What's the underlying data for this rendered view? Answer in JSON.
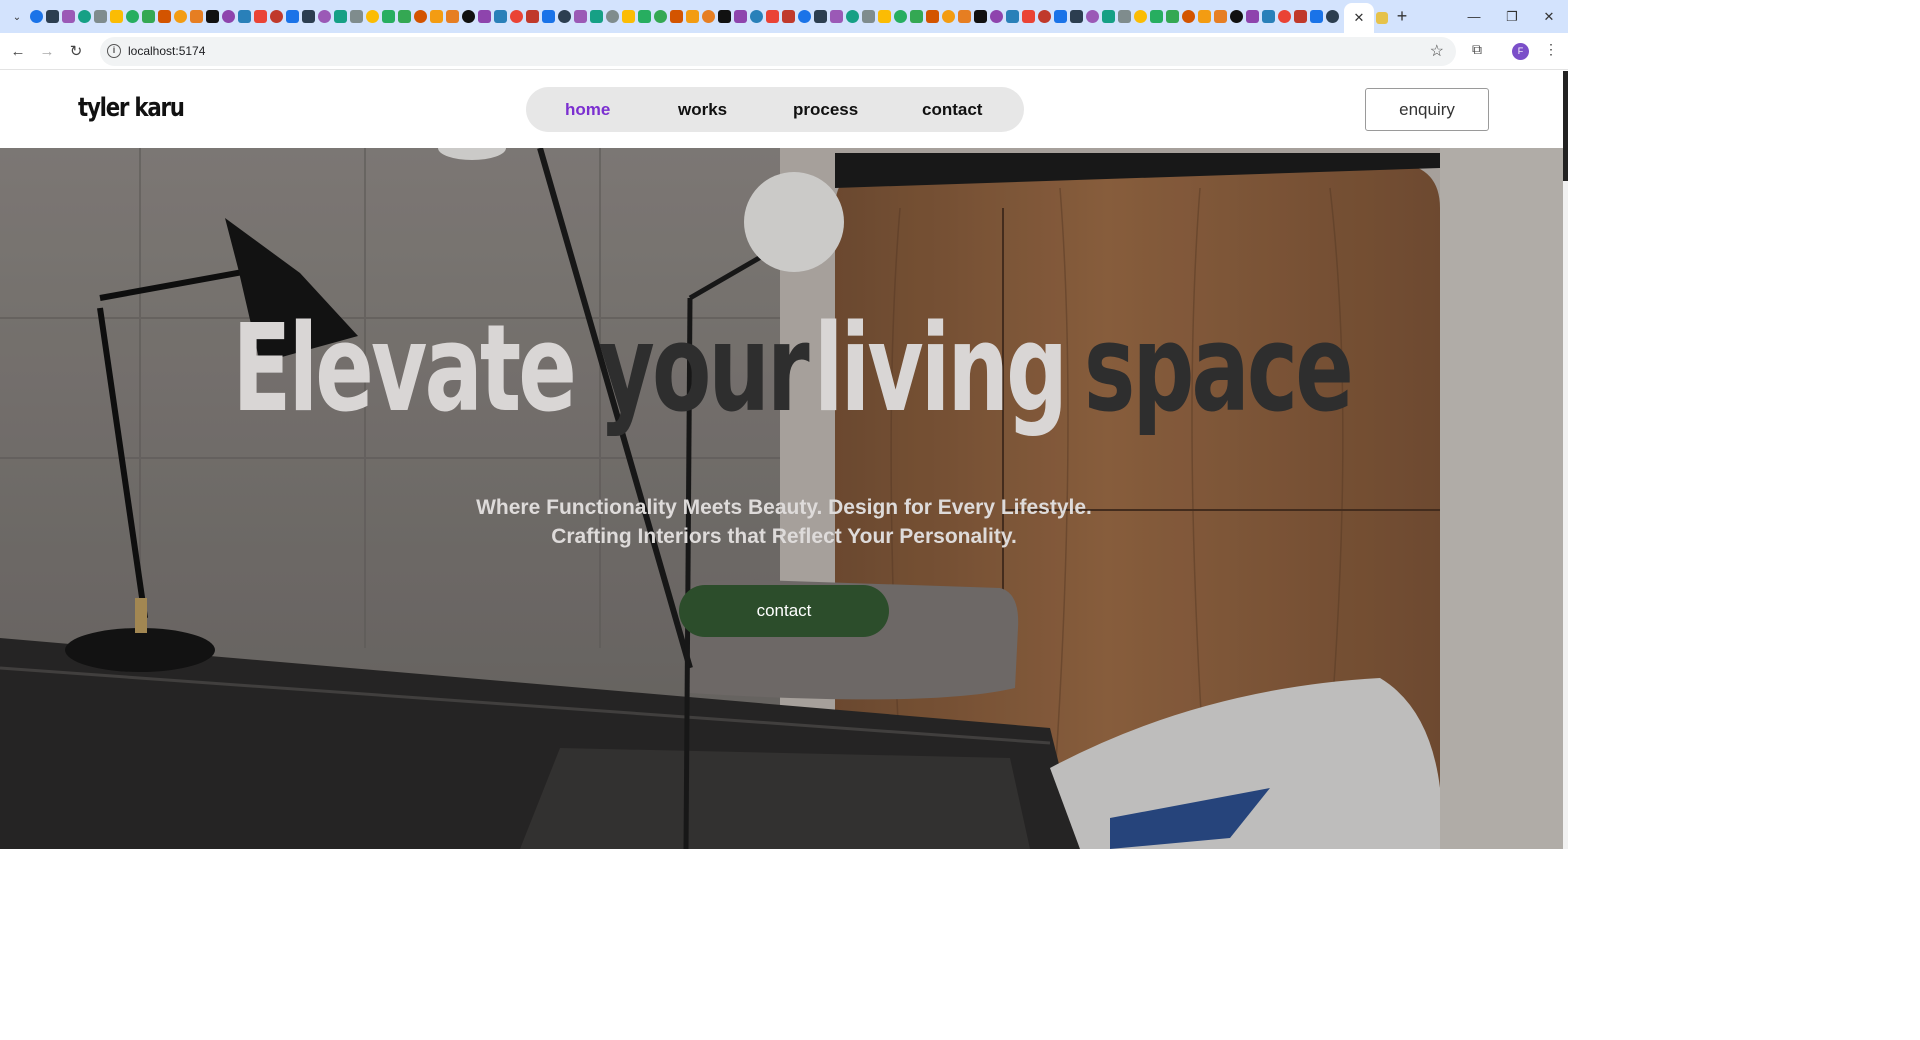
{
  "browser": {
    "url": "localhost:5174",
    "profile_initial": "F",
    "tab_close_glyph": "✕",
    "new_tab_glyph": "+",
    "window_controls": [
      "—",
      "❐",
      "✕"
    ],
    "icons": [
      "back-icon",
      "forward-icon",
      "reload-icon",
      "site-info-icon",
      "bookmark-star-icon",
      "extensions-icon",
      "kebab-menu-icon"
    ]
  },
  "site": {
    "logo": "tyler karu",
    "nav": [
      {
        "label": "home",
        "active": true
      },
      {
        "label": "works",
        "active": false
      },
      {
        "label": "process",
        "active": false
      },
      {
        "label": "contact",
        "active": false
      }
    ],
    "enquiry_label": "enquiry"
  },
  "hero": {
    "headline_words": [
      {
        "text": "Elevate",
        "tone": "light"
      },
      {
        "text": "your",
        "tone": "dark"
      },
      {
        "text": "living",
        "tone": "light"
      },
      {
        "text": "space",
        "tone": "dark"
      }
    ],
    "tagline_line1": "Where Functionality Meets Beauty. Design for Every Lifestyle.",
    "tagline_line2": "Crafting Interiors that Reflect Your Personality.",
    "cta_label": "contact"
  },
  "colors": {
    "tabbar": "#d3e3fd",
    "nav_active": "#7b2fd0",
    "cta": "#2c4d2b",
    "headline_light": "#d9d6d5",
    "headline_dark": "#2e2e2e"
  }
}
